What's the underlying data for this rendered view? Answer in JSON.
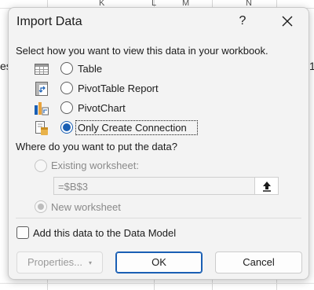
{
  "background": {
    "column_headers": [
      "K",
      "L",
      "M",
      "N"
    ],
    "cell_left": "es",
    "cell_right": "1"
  },
  "dialog": {
    "title": "Import Data",
    "help_label": "?",
    "prompt": "Select how you want to view this data in your workbook.",
    "view_options": [
      {
        "label": "Table",
        "icon": "table-icon",
        "checked": false
      },
      {
        "label": "PivotTable Report",
        "icon": "pivottable-icon",
        "checked": false
      },
      {
        "label": "PivotChart",
        "icon": "pivotchart-icon",
        "checked": false
      },
      {
        "label": "Only Create Connection",
        "icon": "connection-icon",
        "checked": true
      }
    ],
    "where_prompt": "Where do you want to put the data?",
    "existing_worksheet_label": "Existing worksheet:",
    "existing_reference": "=$B$3",
    "new_worksheet_label": "New worksheet",
    "new_worksheet_checked": true,
    "data_model_label": "Add this data to the Data Model",
    "data_model_checked": false,
    "buttons": {
      "properties": "Properties...",
      "ok": "OK",
      "cancel": "Cancel"
    },
    "accent_color": "#1a5fb4"
  }
}
